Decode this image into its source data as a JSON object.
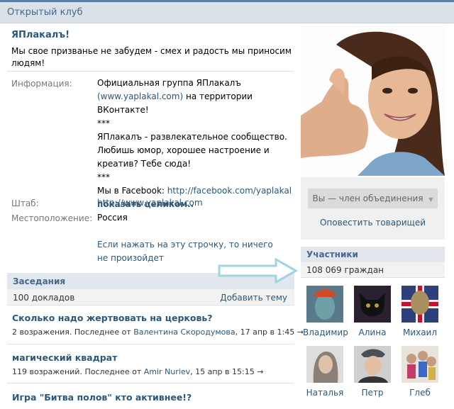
{
  "header": {
    "title": "Открытый клуб"
  },
  "group": {
    "name": "ЯПлакалъ!",
    "status": "Мы свое призванье не забудем - смех и радость мы приносим людям!"
  },
  "info": {
    "label": "Информация:",
    "line1": "Официальная группа ЯПлакалъ",
    "line2_link": "(www.yaplakal.com)",
    "line2_rest": " на территории ВКонтакте!",
    "stars1": "***",
    "line3": "ЯПлакалъ - развлекательное сообщество. Любишь юмор, хорошее настроение и креатив? Тебе сюда!",
    "stars2": "***",
    "fb_prefix": "Мы в Facebook: ",
    "fb_link": "http://facebook.com/yaplakal",
    "show_full": "показать целиком.."
  },
  "hq": {
    "label": "Штаб:",
    "value": "http://www.yaplakal.com"
  },
  "location": {
    "label": "Местоположение:",
    "value": "Россия"
  },
  "note_link": "Если нажать на эту строчку, то ничего не произойдет",
  "meetings": {
    "title": "Заседания",
    "count": "100 докладов",
    "add": "Добавить тему",
    "topics": [
      {
        "title": "Сколько надо жертвовать на церковь?",
        "meta_prefix": "2 возражения. Последнее от ",
        "user": "Валентина Скородумова",
        "date": ", 17 апр в 1:45",
        "arrow": "→"
      },
      {
        "title": "магический квадрат",
        "meta_prefix": "119 возражений. Последнее от ",
        "user": "Amir Nuriev",
        "date": ", 15 апр в 15:15",
        "arrow": "→"
      },
      {
        "title": "Игра \"Битва полов\" кто активнее!?"
      }
    ]
  },
  "membership": {
    "member_button": "Вы — член объединения",
    "dropdown_icon": "▼",
    "notify": "Оповестить товарищей"
  },
  "members": {
    "title": "Участники",
    "count": "108 069 граждан",
    "list": [
      {
        "name": "Владимир",
        "color": "#5a7a8a"
      },
      {
        "name": "Алина",
        "color": "#2a2030"
      },
      {
        "name": "Михаил",
        "color": "#a89060"
      },
      {
        "name": "Наталья",
        "color": "#8a8078"
      },
      {
        "name": "Петр",
        "color": "#4a5058"
      },
      {
        "name": "Глеб",
        "color": "#c49a80"
      }
    ]
  }
}
